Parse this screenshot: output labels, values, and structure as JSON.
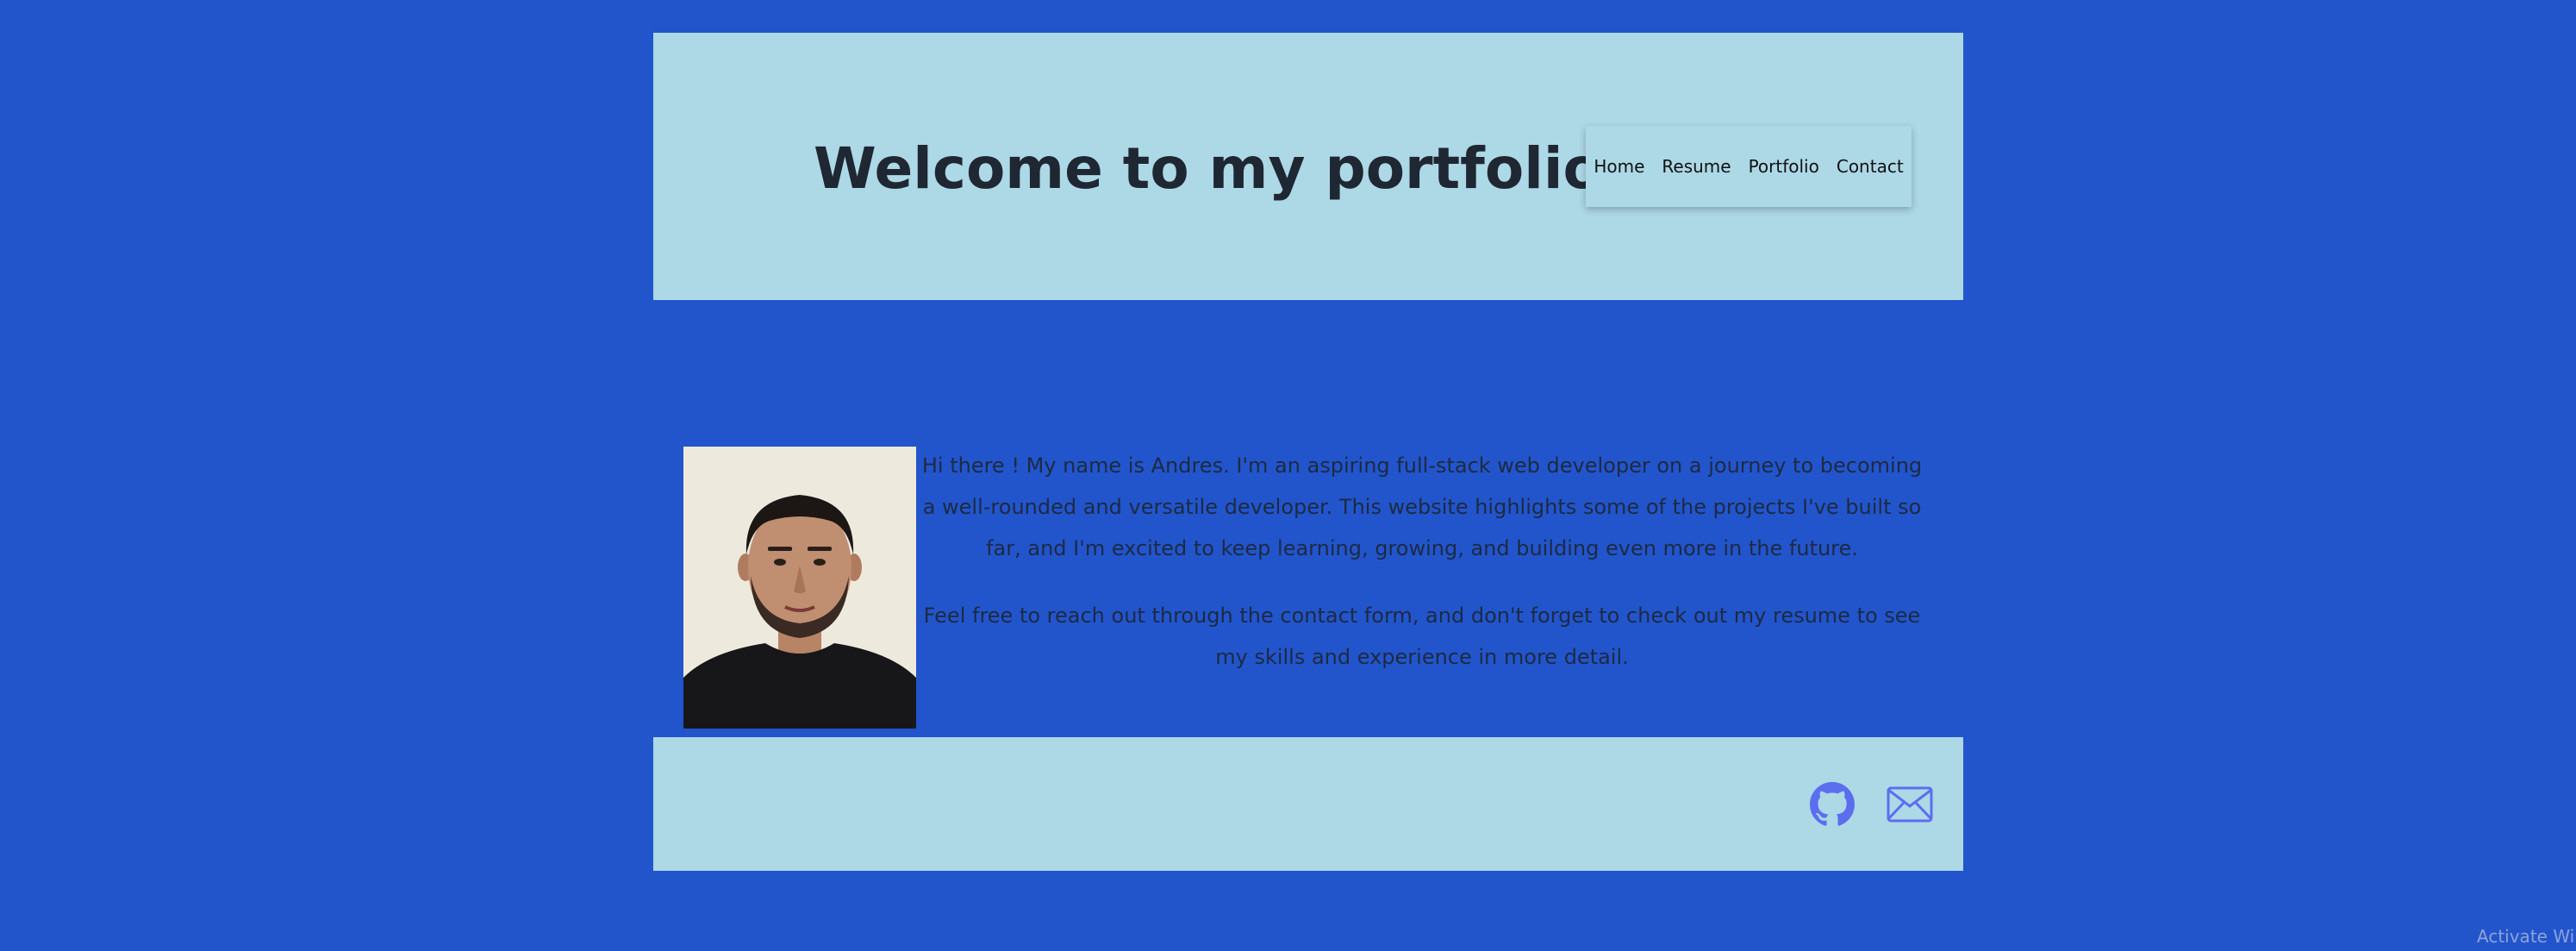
{
  "header": {
    "title": "Welcome to my portfolio!!",
    "nav": [
      "Home",
      "Resume",
      "Portfolio",
      "Contact"
    ]
  },
  "about": {
    "paragraphs": [
      "Hi there ! My name is Andres. I'm an aspiring full-stack web developer on a journey to becoming a well-rounded and versatile developer. This website highlights some of the projects I've built so far, and I'm excited to keep learning, growing, and building even more in the future.",
      "Feel free to reach out through the contact form, and don't forget to check out my resume to see my skills and experience in more detail."
    ]
  },
  "footer": {
    "icons": [
      "github-icon",
      "email-icon"
    ]
  },
  "watermark": "Activate Windows",
  "colors": {
    "page_background": "#2255cc",
    "panel_background": "#add8e6",
    "icon_color": "#5b6ef0"
  }
}
